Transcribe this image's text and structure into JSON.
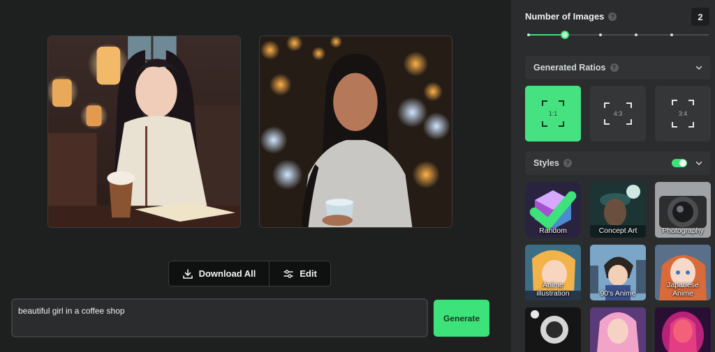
{
  "actions": {
    "download_all_label": "Download All",
    "edit_label": "Edit"
  },
  "prompt": {
    "value": "beautiful girl in a coffee shop",
    "generate_label": "Generate"
  },
  "number_of_images": {
    "title": "Number of Images",
    "value": "2",
    "options": [
      1,
      2,
      3,
      4,
      5
    ],
    "selected_index": 1
  },
  "ratios": {
    "title": "Generated Ratios",
    "items": [
      {
        "label": "1:1",
        "selected": true
      },
      {
        "label": "4:3",
        "selected": false
      },
      {
        "label": "3:4",
        "selected": false
      }
    ]
  },
  "styles": {
    "title": "Styles",
    "enabled": true,
    "items": [
      {
        "label": "Random",
        "selected": true
      },
      {
        "label": "Concept Art",
        "selected": false
      },
      {
        "label": "Photography",
        "selected": false
      },
      {
        "label": "Anime illustration",
        "selected": false
      },
      {
        "label": "90's Anime",
        "selected": false
      },
      {
        "label": "Japanese Anime",
        "selected": false
      },
      {
        "label": "",
        "selected": false
      },
      {
        "label": "",
        "selected": false
      },
      {
        "label": "",
        "selected": false
      }
    ]
  },
  "colors": {
    "accent": "#3ee27a",
    "background": "#1e2020",
    "sidebar": "#2a2c2d"
  }
}
